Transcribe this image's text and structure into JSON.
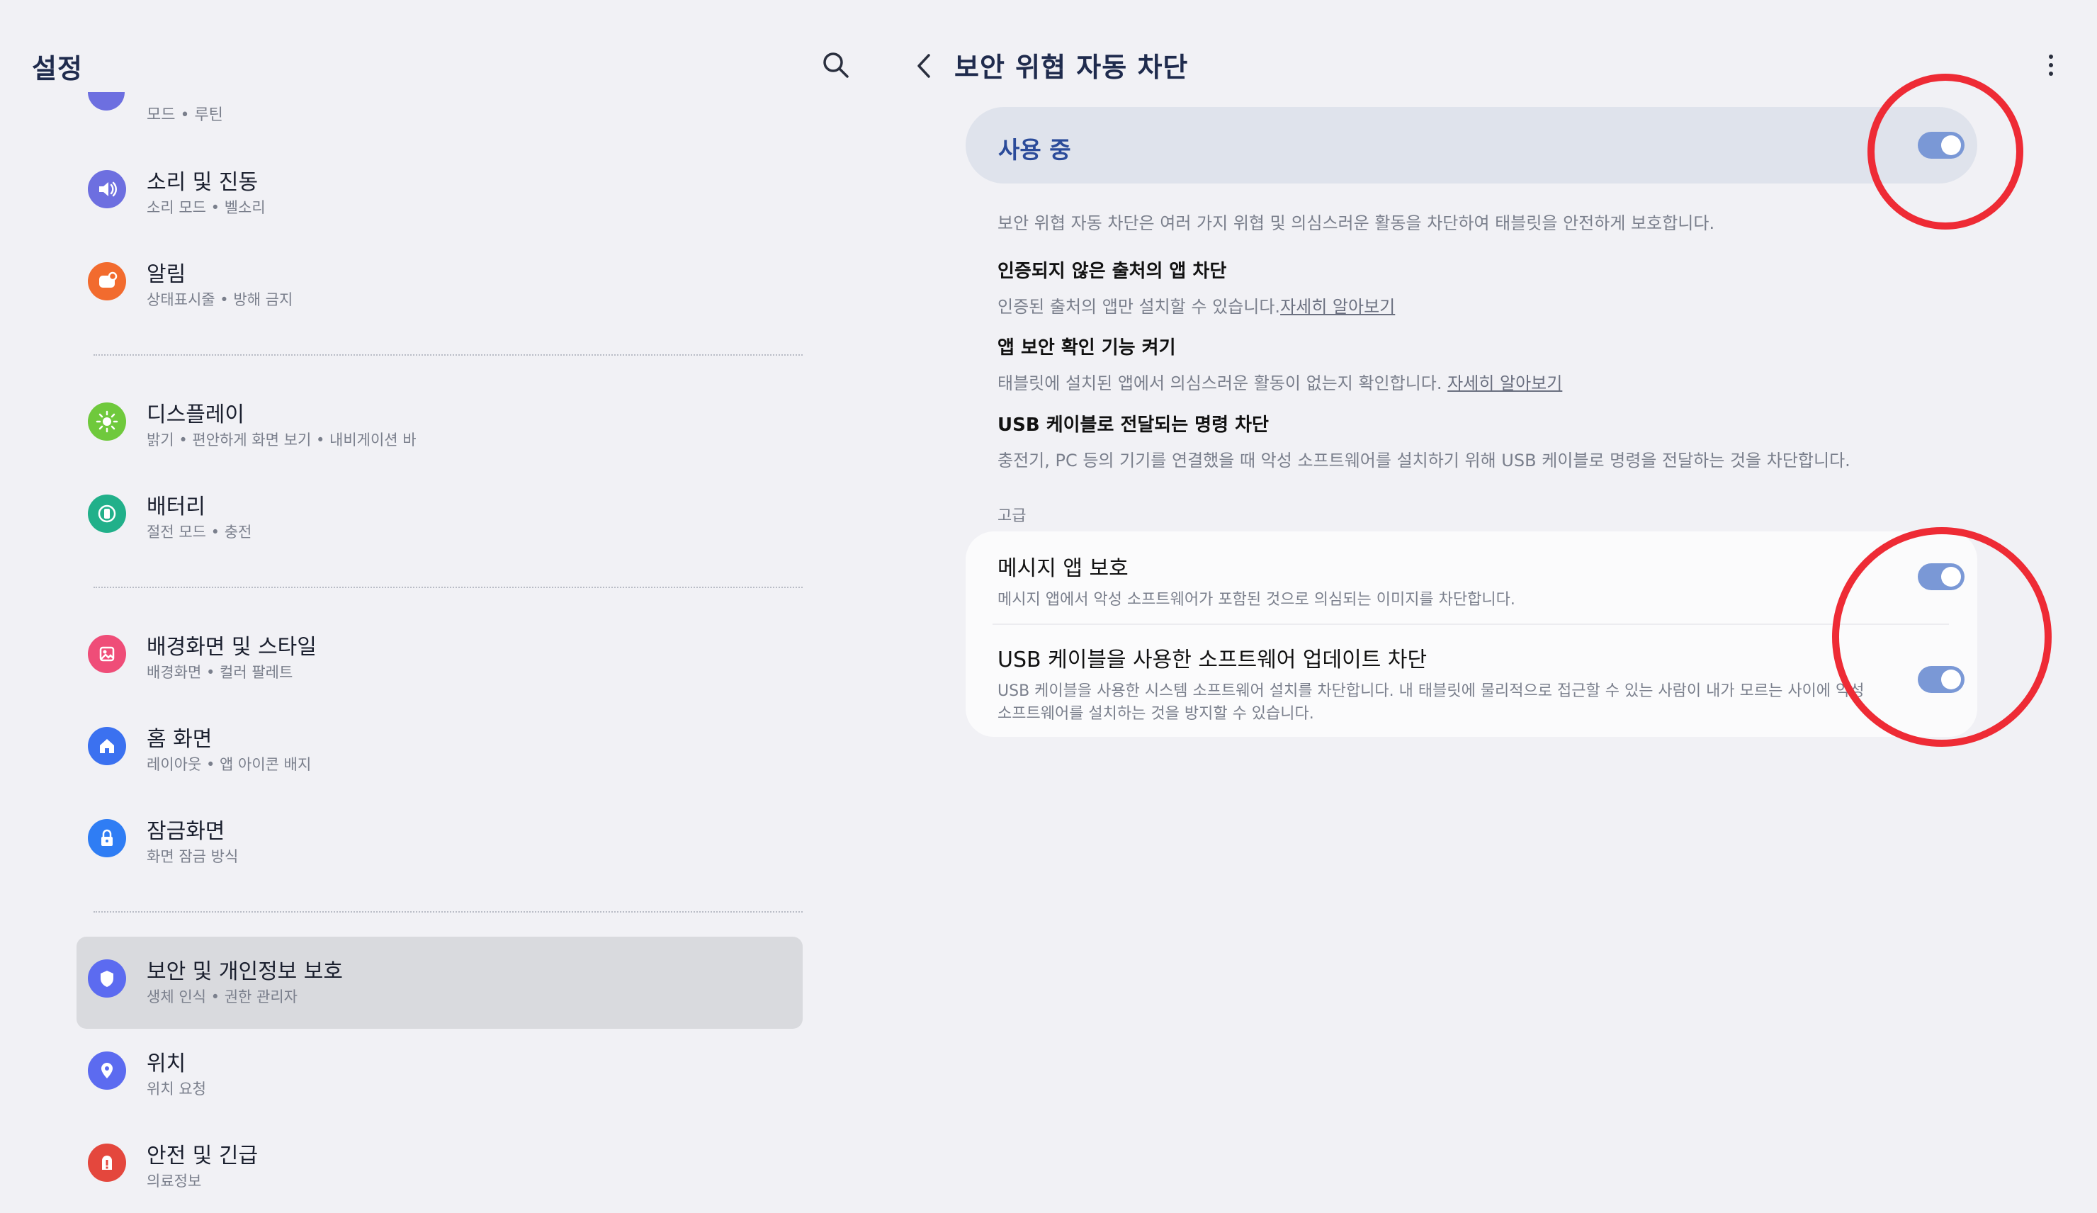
{
  "left": {
    "title": "설정",
    "partial_item_sub": "모드 • 루틴",
    "items": [
      {
        "label": "소리 및 진동",
        "sub": "소리 모드 • 벨소리",
        "icon": "speaker-icon",
        "color": "#6d6fe0"
      },
      {
        "label": "알림",
        "sub": "상태표시줄 • 방해 금지",
        "icon": "notification-icon",
        "color": "#f26b2e"
      },
      {
        "label": "디스플레이",
        "sub": "밝기 • 편안하게 화면 보기 • 내비게이션 바",
        "icon": "sun-icon",
        "color": "#6fc93c"
      },
      {
        "label": "배터리",
        "sub": "절전 모드 • 충전",
        "icon": "battery-icon",
        "color": "#21b08a"
      },
      {
        "label": "배경화면 및 스타일",
        "sub": "배경화면 • 컬러 팔레트",
        "icon": "palette-icon",
        "color": "#ef4d78"
      },
      {
        "label": "홈 화면",
        "sub": "레이아웃 • 앱 아이콘 배지",
        "icon": "home-icon",
        "color": "#3b71f0"
      },
      {
        "label": "잠금화면",
        "sub": "화면 잠금 방식",
        "icon": "lock-icon",
        "color": "#2f7df4"
      },
      {
        "label": "보안 및 개인정보 보호",
        "sub": "생체 인식 • 권한 관리자",
        "icon": "shield-icon",
        "color": "#5c6bf0"
      },
      {
        "label": "위치",
        "sub": "위치 요청",
        "icon": "location-pin-icon",
        "color": "#5c6bf0"
      },
      {
        "label": "안전 및 긴급",
        "sub": "의료정보",
        "icon": "alert-icon",
        "color": "#e4473d"
      }
    ]
  },
  "right": {
    "title": "보안 위협 자동 차단",
    "master_label": "사용 중",
    "master_on": true,
    "description": "보안 위협 자동 차단은 여러 가지 위협 및 의심스러운 활동을 차단하여 태블릿을 안전하게 보호합니다.",
    "info": [
      {
        "title": "인증되지 않은 출처의 앱 차단",
        "sub": "인증된 출처의 앱만 설치할 수 있습니다.",
        "link": "자세히 알아보기"
      },
      {
        "title": "앱 보안 확인 기능 켜기",
        "sub": "태블릿에 설치된 앱에서 의심스러운 활동이 없는지 확인합니다. ",
        "link": "자세히 알아보기"
      },
      {
        "title": "USB 케이블로 전달되는 명령 차단",
        "sub": "충전기, PC 등의 기기를 연결했을 때 악성 소프트웨어를 설치하기 위해 USB 케이블로 명령을 전달하는 것을 차단합니다.",
        "link": ""
      }
    ],
    "section_label": "고급",
    "advanced": [
      {
        "title": "메시지 앱 보호",
        "sub": "메시지 앱에서 악성 소프트웨어가 포함된 것으로 의심되는 이미지를 차단합니다.",
        "on": true
      },
      {
        "title": "USB 케이블을 사용한 소프트웨어 업데이트 차단",
        "sub_line1": "USB 케이블을 사용한 시스템 소프트웨어 설치를 차단합니다. 내 태블릿에 물리적으로 접근할 수 있는 사람이 내가 모르는 사이에 악성",
        "sub_line2": "소프트웨어를 설치하는 것을 방지할 수 있습니다.",
        "on": true
      }
    ]
  },
  "colors": {
    "accent": "#2b4b9a",
    "toggle_on": "#7a98d6",
    "annotation": "#ee2b35"
  }
}
